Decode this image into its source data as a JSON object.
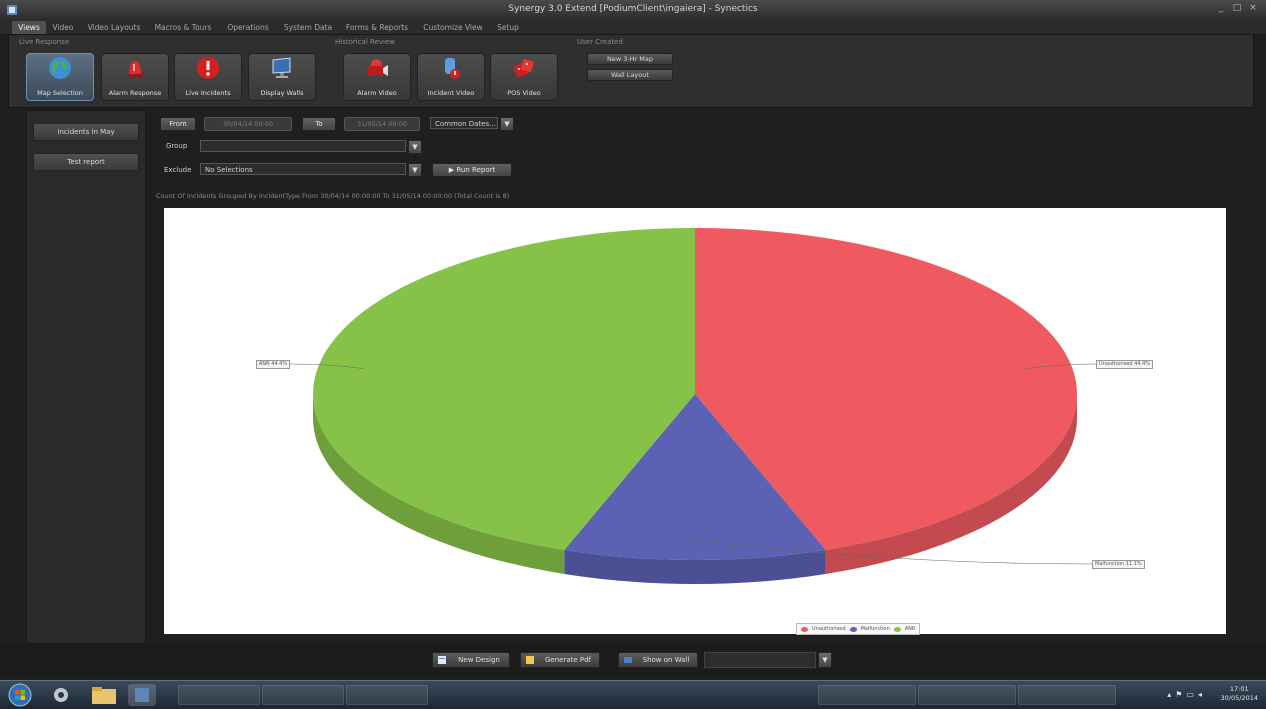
{
  "window": {
    "title": "Synergy 3.0 Extend [PodiumClient\\ingaiera] - Synectics",
    "controls": [
      "_",
      "□",
      "×"
    ]
  },
  "menu": {
    "tabs": [
      "Views",
      "Video",
      "Video Layouts",
      "Macros & Tours",
      "Operations",
      "System Data",
      "Forms & Reports",
      "Customize View",
      "Setup"
    ],
    "active": "Views"
  },
  "ribbon": {
    "groups": {
      "live": "Live Response",
      "historical": "Historical Review",
      "user": "User Created"
    },
    "buttons": [
      {
        "label": "Map Selection",
        "icon": "globe-icon"
      },
      {
        "label": "Alarm Response",
        "icon": "alarm-siren-icon"
      },
      {
        "label": "Live Incidents",
        "icon": "incident-warning-icon"
      },
      {
        "label": "Display Walls",
        "icon": "display-monitor-icon"
      },
      {
        "label": "Alarm Video",
        "icon": "alarm-video-icon"
      },
      {
        "label": "Incident Video",
        "icon": "incident-video-icon"
      },
      {
        "label": "POS Video",
        "icon": "pos-video-icon"
      }
    ],
    "user_buttons": [
      "New 3-Hr Map",
      "Wall Layout"
    ]
  },
  "left_panel": {
    "items": [
      "Incidents in May",
      "Test report"
    ]
  },
  "filters": {
    "from_label": "From",
    "from_value": "30/04/14 00:00",
    "to_label": "To",
    "to_value": "31/05/14 00:00",
    "common_dates": "Common Dates...",
    "group_label": "Group",
    "group_value": "",
    "exclude_label": "Exclude",
    "exclude_value": "No Selections",
    "run_report": "Run Report"
  },
  "chart_caption": "Count Of Incidents Grouped By IncidentType From 30/04/14 00:00:00 To 31/05/14 00:00:00 (Total Count is 8)",
  "chart_data": {
    "type": "pie",
    "categories": [
      "Unauthorised",
      "Malfunction",
      "ANR"
    ],
    "values": [
      44.4,
      11.1,
      44.4
    ],
    "colors": [
      "#ee5a5f",
      "#5b62b4",
      "#86c247"
    ],
    "data_labels": [
      "Unauthorised 44.4%",
      "Malfunction 11.1%",
      "ANR 44.4%"
    ],
    "legend": [
      "Unauthorised",
      "Malfunction",
      "ANR"
    ],
    "legend_position": "bottom-center",
    "grid": false,
    "title": ""
  },
  "bottom": {
    "new_design": "New Design",
    "generate_pdf": "Generate Pdf",
    "show_on_wall": "Show on Wall",
    "wall_select": ""
  },
  "taskbar": {
    "time": "17:01",
    "date": "30/05/2014"
  }
}
